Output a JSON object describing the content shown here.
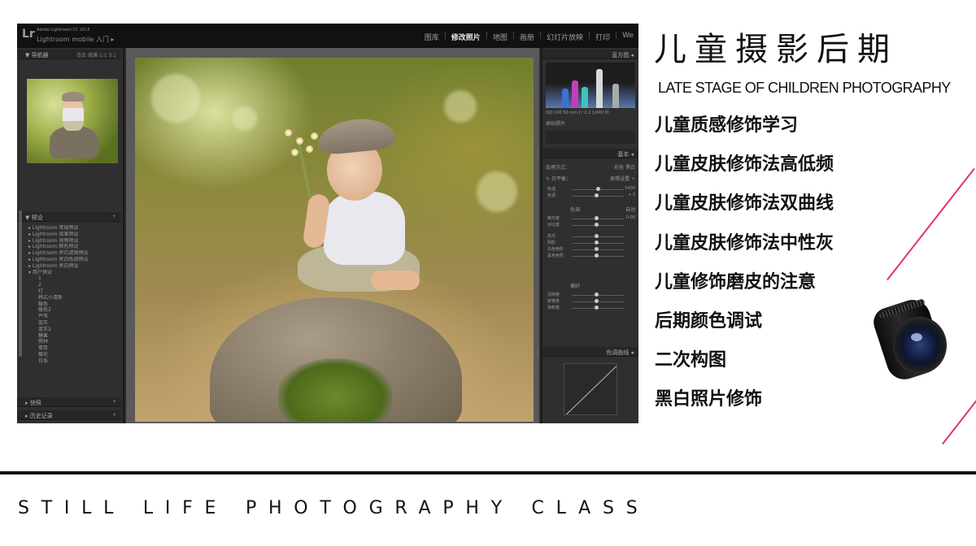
{
  "lightroom": {
    "logo": "Lr",
    "brand_small": "Adobe Lightroom CC 2015",
    "brand_mobile": "Lightroom mobile 入门 ▸",
    "modules": [
      "图库",
      "修改照片",
      "地图",
      "画册",
      "幻灯片放映",
      "打印",
      "We"
    ],
    "active_module": "修改照片",
    "navigator": {
      "title": "▼ 导航器",
      "views": "适合  填满  1:1  3:1"
    },
    "presets": {
      "title": "▼ 预设",
      "items": [
        "▸ Lightroom 常规预设",
        "▸ Lightroom 效果预设",
        "▸ Lightroom 视频预设",
        "▸ Lightroom 颜色预设",
        "▸ Lightroom 黑白滤镜预设",
        "▸ Lightroom 黑白色调预设",
        "▸ Lightroom 黑白预设",
        "▾ 用户预设"
      ],
      "user_items": [
        "1",
        "2",
        "灯",
        "韩式小清新",
        "暖色",
        "暖色2",
        "芦苇",
        "蓝灰",
        "蓝灰2",
        "糖果",
        "雨林",
        "蛋卷",
        "樱花",
        "日系"
      ]
    },
    "snapshots": "▸ 快照",
    "history": "▸ 历史记录",
    "histogram": {
      "title": "直方图 ◂",
      "info": "ISO 100   50 mm   ƒ / 2.2   1/400 秒"
    },
    "original_photo": "原始照片",
    "basic": {
      "title": "基本 ◂",
      "treatment": "处理方式：",
      "treatment_opts": "彩色   黑白",
      "wb": "白平衡：",
      "wb_value": "原照设置 ÷",
      "temp": "色温",
      "temp_value": "5400",
      "tint": "色调",
      "tint_value": "+ 3",
      "tone_title": "色调",
      "auto": "自动",
      "exposure": "曝光度",
      "exposure_value": "0.00",
      "contrast": "对比度",
      "highlights": "高光",
      "shadows": "阴影",
      "whites": "白色色阶",
      "blacks": "黑色色阶",
      "presence_title": "偏好",
      "clarity": "清晰度",
      "vibrance": "鲜艳度",
      "saturation": "饱和度"
    },
    "tone_curve": "色调曲线 ◂"
  },
  "headline": "儿童摄影后期",
  "subhead": "LATE STAGE OF CHILDREN PHOTOGRAPHY",
  "courses": [
    "儿童质感修饰学习",
    "儿童皮肤修饰法高低频",
    "儿童皮肤修饰法双曲线",
    "儿童皮肤修饰法中性灰",
    "儿童修饰磨皮的注意",
    "后期颜色调试",
    "二次构图",
    "黑白照片修饰"
  ],
  "footer": "STILL LIFE PHOTOGRAPHY CLASS",
  "colors": {
    "accent_line": "#e0307a",
    "text": "#111111",
    "background": "#ffffff"
  },
  "icons": [
    "lens-icon",
    "lightroom-logo-icon"
  ]
}
